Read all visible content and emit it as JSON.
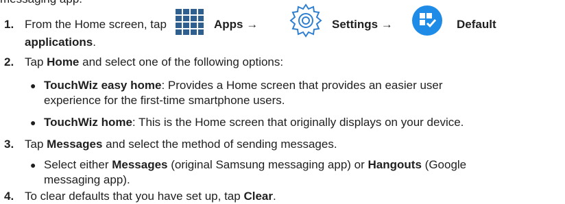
{
  "top_fragment": "messaging app.",
  "step1": {
    "num": "1.",
    "text": "From the Home screen, tap",
    "apps": "Apps",
    "arrow1": "→",
    "settings": "Settings",
    "arrow2": "→",
    "default": "Default",
    "applications": "applications",
    "period": "."
  },
  "step2": {
    "num": "2.",
    "pre": "Tap",
    "home": "Home",
    "post": "and select one of the following options:",
    "b1_title": "TouchWiz easy home",
    "b1_text": ": Provides a Home screen that provides an easier user",
    "b1_cont": "experience for the first-time smartphone users.",
    "b2_title": "TouchWiz home",
    "b2_text": ": This is the Home screen that originally displays on your device."
  },
  "step3": {
    "num": "3.",
    "pre": "Tap",
    "messages": "Messages",
    "post": "and select the method of sending messages.",
    "b1_pre": "Select either",
    "b1_messages": "Messages",
    "b1_mid": "(original Samsung messaging app) or",
    "b1_hangouts": "Hangouts",
    "b1_post": "(Google",
    "b1_cont": "messaging app)."
  },
  "step4": {
    "num": "4.",
    "pre": "To clear defaults that you have set up, tap",
    "clear": "Clear",
    "period": "."
  },
  "icons": {
    "apps": "apps-grid-icon",
    "settings": "settings-gear-icon",
    "default": "default-applications-icon",
    "colors": {
      "apps": "#2f5f8f",
      "settings": "#2f7fd0",
      "default": "#1e8be6"
    }
  }
}
